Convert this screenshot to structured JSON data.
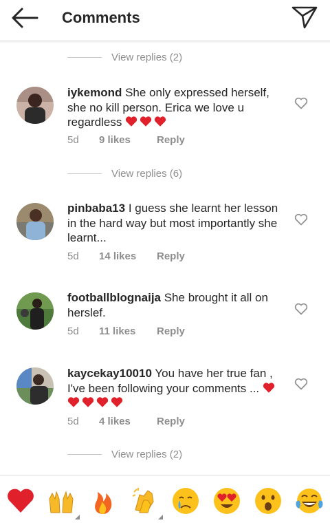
{
  "header": {
    "title": "Comments"
  },
  "replies_top": {
    "label": "View replies (2)"
  },
  "comments": [
    {
      "username": "iykemond",
      "text": " She only expressed herself, she no kill person. Erica we love u regardless",
      "hearts": 3,
      "time": "5d",
      "likes": "9 likes",
      "reply": "Reply",
      "view_replies": "View replies (6)"
    },
    {
      "username": "pinbaba13",
      "text": " I guess she learnt her lesson in the hard way but most importantly she learnt...",
      "hearts": 0,
      "time": "5d",
      "likes": "14 likes",
      "reply": "Reply"
    },
    {
      "username": "footballblognaija",
      "text": " She brought it all on herslef.",
      "hearts": 0,
      "time": "5d",
      "likes": "11 likes",
      "reply": "Reply"
    },
    {
      "username": "kaycekay10010",
      "text": " You have her true fan , I've been following your comments ...",
      "hearts": 5,
      "time": "5d",
      "likes": "4 likes",
      "reply": "Reply",
      "view_replies": "View replies (2)"
    }
  ],
  "emoji_bar": [
    "red-heart",
    "raised-hands",
    "fire",
    "clapping-hands",
    "crying-face",
    "heart-eyes-face",
    "astonished-face",
    "tears-of-joy-face"
  ],
  "colors": {
    "accent_heart": "#e0202a",
    "muted": "#8e8e8e",
    "text": "#262626"
  }
}
